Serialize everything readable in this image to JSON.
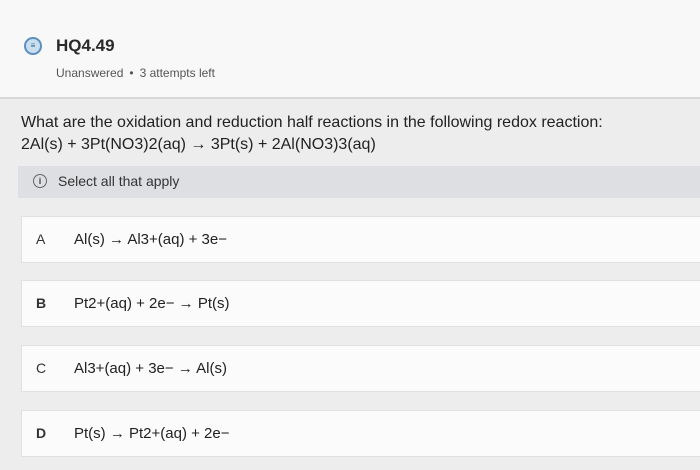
{
  "header": {
    "title": "HQ4.49",
    "status": "Unanswered",
    "separator": "•",
    "attempts": "3 attempts left"
  },
  "question": {
    "prompt": "What are the oxidation and reduction half reactions in the following redox reaction:",
    "reaction": "2Al(s) + 3Pt(NO3)2(aq) → 3Pt(s) + 2Al(NO3)3(aq)"
  },
  "hint": {
    "label": "Select all that apply",
    "icon": "info-icon"
  },
  "options": [
    {
      "letter": "A",
      "text": "Al(s) → Al3+(aq) + 3e−"
    },
    {
      "letter": "B",
      "text": "Pt2+(aq) + 2e− → Pt(s)"
    },
    {
      "letter": "C",
      "text": "Al3+(aq) + 3e− → Al(s)"
    },
    {
      "letter": "D",
      "text": "Pt(s) → Pt2+(aq) + 2e−"
    }
  ],
  "colors": {
    "header_bg": "#f8f8f8",
    "page_bg": "#ededed",
    "hint_bg": "#dedfe3",
    "option_bg": "#fbfbfb",
    "icon_accent": "#5a8fbf"
  }
}
